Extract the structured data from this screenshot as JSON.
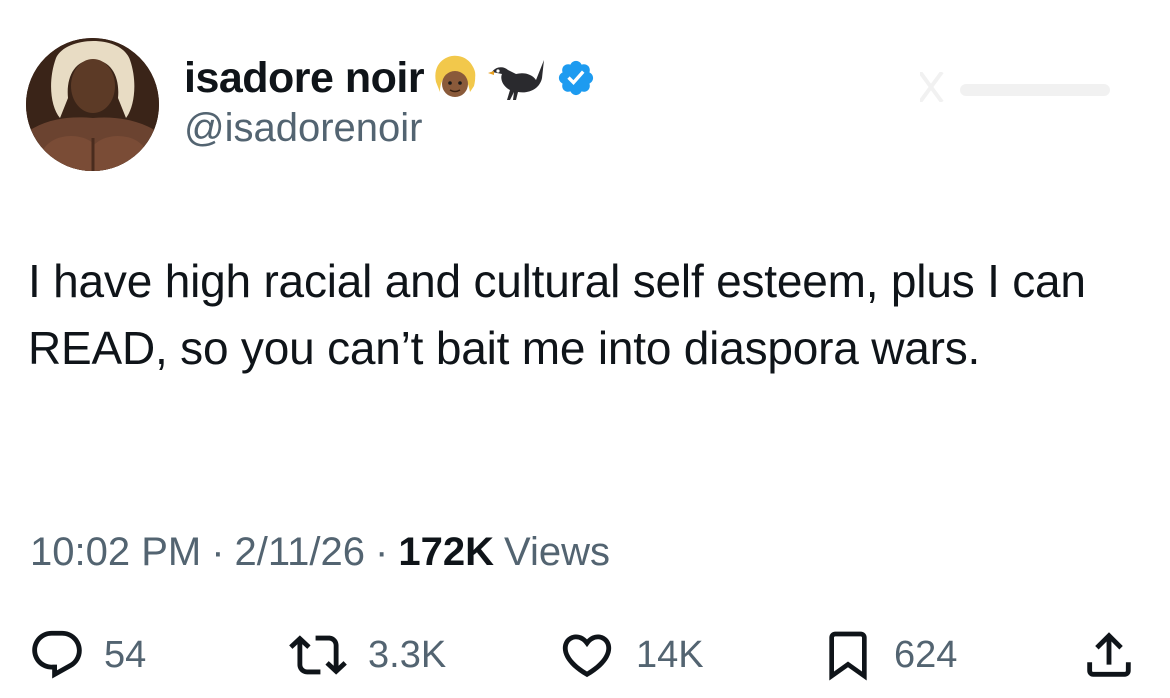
{
  "user": {
    "display_name": "isadore noir",
    "handle": "@isadorenoir",
    "verified": true,
    "name_emojis": [
      "woman-blond-hair-emoji",
      "blackbird-emoji"
    ],
    "avatar_icon": "profile-photo"
  },
  "tweet": {
    "text": "I have high racial and cultural self esteem, plus I can READ,  so you can’t bait me into diaspora wars."
  },
  "meta": {
    "time": "10:02 PM",
    "separator": "·",
    "date": "2/11/26",
    "views_count": "172K",
    "views_label": "Views"
  },
  "actions": {
    "replies": "54",
    "reposts": "3.3K",
    "likes": "14K",
    "bookmarks": "624"
  },
  "colors": {
    "text_primary": "#0f1419",
    "text_secondary": "#536471",
    "verified_blue": "#1d9bf0",
    "background": "#ffffff"
  }
}
